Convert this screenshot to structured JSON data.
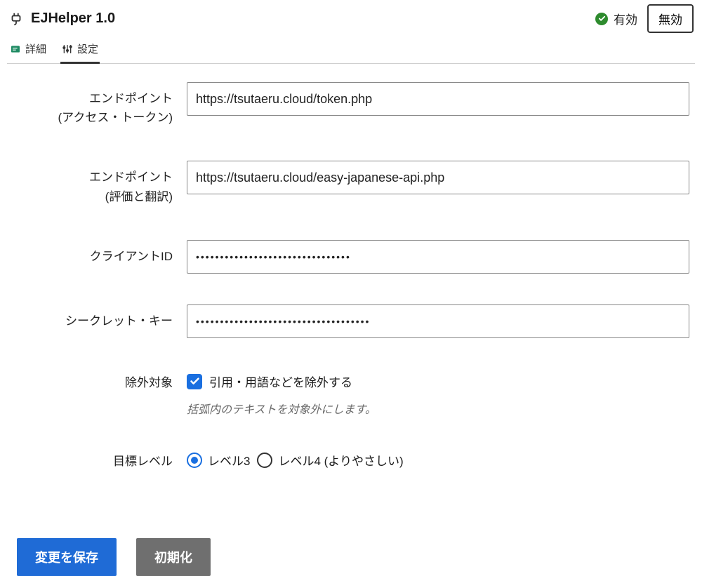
{
  "header": {
    "title": "EJHelper 1.0",
    "enabled_label": "有効",
    "disable_button": "無効"
  },
  "tabs": {
    "details": "詳細",
    "settings": "設定",
    "active": "settings"
  },
  "form": {
    "endpoint_token": {
      "label_line1": "エンドポイント",
      "label_line2": "(アクセス・トークン)",
      "value": "https://tsutaeru.cloud/token.php"
    },
    "endpoint_api": {
      "label_line1": "エンドポイント",
      "label_line2": "(評価と翻訳)",
      "value": "https://tsutaeru.cloud/easy-japanese-api.php"
    },
    "client_id": {
      "label": "クライアントID",
      "value": "••••••••••••••••••••••••••••••••"
    },
    "secret_key": {
      "label": "シークレット・キー",
      "value": "••••••••••••••••••••••••••••••••••••"
    },
    "exclusion": {
      "label": "除外対象",
      "checkbox_label": "引用・用語などを除外する",
      "checked": true,
      "help": "括弧内のテキストを対象外にします。"
    },
    "target_level": {
      "label": "目標レベル",
      "options": [
        {
          "id": "level3",
          "label": "レベル3",
          "selected": true
        },
        {
          "id": "level4",
          "label": "レベル4 (よりやさしい)",
          "selected": false
        }
      ]
    }
  },
  "footer": {
    "save": "変更を保存",
    "reset": "初期化"
  }
}
